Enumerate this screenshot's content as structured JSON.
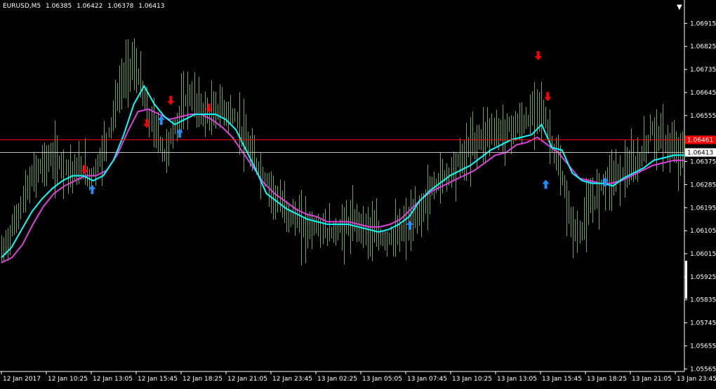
{
  "window": {
    "symbol": "EURUSD,M5",
    "open": "1.06385",
    "high": "1.06422",
    "low": "1.06378",
    "close": "1.06413",
    "collapse_icon": "triangle-down-icon"
  },
  "colors": {
    "background": "#000000",
    "bars": "#6aa84f",
    "ma_fast": "#00ffff",
    "ma_slow": "#e040e0",
    "buy_arrow": "#1e90ff",
    "sell_arrow": "#ff0000",
    "grid_text": "#ffffff",
    "red_line": "#ff0000",
    "gray_line": "#c0c0c0"
  },
  "chart_data": {
    "type": "ohlc",
    "y_range": [
      1.06555,
      1.06968
    ],
    "price_ticks": [
      "1.06915",
      "1.06825",
      "1.06735",
      "1.06645",
      "1.06555",
      "1.06465",
      "1.06375",
      "1.06285",
      "1.06195",
      "1.06105",
      "1.06015",
      "1.05925",
      "1.05835",
      "1.05745",
      "1.05655",
      "1.05565"
    ],
    "time_labels": [
      "12 Jan 2017",
      "12 Jan 10:25",
      "12 Jan 13:05",
      "12 Jan 15:45",
      "12 Jan 18:25",
      "12 Jan 21:05",
      "12 Jan 23:45",
      "13 Jan 02:25",
      "13 Jan 05:05",
      "13 Jan 07:45",
      "13 Jan 10:25",
      "13 Jan 13:05",
      "13 Jan 15:45",
      "13 Jan 18:25",
      "13 Jan 21:05",
      "13 Jan 23:45"
    ],
    "price_lines": [
      {
        "name": "ask-line",
        "value": 1.06461,
        "label": "1.06461"
      },
      {
        "name": "bid-line",
        "value": 1.06413,
        "label": "1.06413"
      }
    ],
    "close_path": [
      1.06015,
      1.06085,
      1.06165,
      1.06255,
      1.06325,
      1.06365,
      1.06385,
      1.06375,
      1.06355,
      1.06335,
      1.06345,
      1.0631,
      1.06375,
      1.0647,
      1.066,
      1.067,
      1.0676,
      1.067,
      1.0655,
      1.065,
      1.064,
      1.0648,
      1.0656,
      1.0664,
      1.066,
      1.0656,
      1.0656,
      1.0659,
      1.0656,
      1.0654,
      1.0645,
      1.0638,
      1.0633,
      1.0628,
      1.0622,
      1.0618,
      1.0616,
      1.0612,
      1.0612,
      1.0612,
      1.061,
      1.061,
      1.0612,
      1.0613,
      1.0614,
      1.0611,
      1.0609,
      1.0607,
      1.0608,
      1.0609,
      1.0613,
      1.0615,
      1.0621,
      1.0627,
      1.0631,
      1.0633,
      1.0637,
      1.064,
      1.0645,
      1.0647,
      1.065,
      1.0649,
      1.065,
      1.0651,
      1.0652,
      1.0654,
      1.0662,
      1.0652,
      1.0641,
      1.063,
      1.0614,
      1.0608,
      1.0618,
      1.0623,
      1.063,
      1.0632,
      1.0633,
      1.0635,
      1.0635,
      1.0642,
      1.065,
      1.0647,
      1.0644,
      1.0641,
      1.0641
    ],
    "ma_fast": [
      1.06,
      1.0604,
      1.0611,
      1.0618,
      1.0623,
      1.0627,
      1.063,
      1.0632,
      1.0632,
      1.063,
      1.0632,
      1.0638,
      1.0648,
      1.066,
      1.0667,
      1.066,
      1.0655,
      1.0652,
      1.0654,
      1.0656,
      1.0656,
      1.0656,
      1.0654,
      1.065,
      1.0642,
      1.0634,
      1.0625,
      1.0622,
      1.0619,
      1.0617,
      1.0615,
      1.0614,
      1.0613,
      1.0613,
      1.0613,
      1.0612,
      1.0611,
      1.061,
      1.0611,
      1.0613,
      1.0616,
      1.0622,
      1.0626,
      1.0629,
      1.0632,
      1.0634,
      1.0636,
      1.0639,
      1.0642,
      1.0644,
      1.0646,
      1.0647,
      1.0648,
      1.0652,
      1.0643,
      1.0642,
      1.0633,
      1.063,
      1.0629,
      1.0629,
      1.0628,
      1.0631,
      1.0633,
      1.0635,
      1.0638,
      1.0639,
      1.064,
      1.064
    ],
    "ma_slow": [
      1.0598,
      1.06,
      1.0605,
      1.0613,
      1.062,
      1.0625,
      1.0628,
      1.063,
      1.0632,
      1.0632,
      1.0634,
      1.064,
      1.0649,
      1.0657,
      1.0658,
      1.0656,
      1.0654,
      1.0655,
      1.0656,
      1.0656,
      1.0654,
      1.0651,
      1.0647,
      1.0641,
      1.0635,
      1.0629,
      1.0625,
      1.0622,
      1.0619,
      1.0617,
      1.0616,
      1.0614,
      1.0614,
      1.0614,
      1.0613,
      1.0612,
      1.0612,
      1.0613,
      1.0615,
      1.0619,
      1.0623,
      1.0626,
      1.0628,
      1.063,
      1.0632,
      1.0634,
      1.0637,
      1.064,
      1.0641,
      1.0644,
      1.0645,
      1.0647,
      1.0644,
      1.0641,
      1.0636,
      1.0631,
      1.063,
      1.0629,
      1.0629,
      1.063,
      1.0632,
      1.0634,
      1.0636,
      1.0637,
      1.0638,
      1.0638
    ],
    "buy_signals": [
      {
        "x_frac": 0.133,
        "price": 1.06265
      },
      {
        "x_frac": 0.234,
        "price": 1.06535
      },
      {
        "x_frac": 0.261,
        "price": 1.06485
      },
      {
        "x_frac": 0.598,
        "price": 1.06125
      },
      {
        "x_frac": 0.797,
        "price": 1.06285
      },
      {
        "x_frac": 0.884,
        "price": 1.06295
      }
    ],
    "sell_signals": [
      {
        "x_frac": 0.122,
        "price": 1.06345
      },
      {
        "x_frac": 0.213,
        "price": 1.06525
      },
      {
        "x_frac": 0.248,
        "price": 1.06615
      },
      {
        "x_frac": 0.304,
        "price": 1.06585
      },
      {
        "x_frac": 0.786,
        "price": 1.0679
      },
      {
        "x_frac": 0.8,
        "price": 1.0663
      }
    ]
  }
}
